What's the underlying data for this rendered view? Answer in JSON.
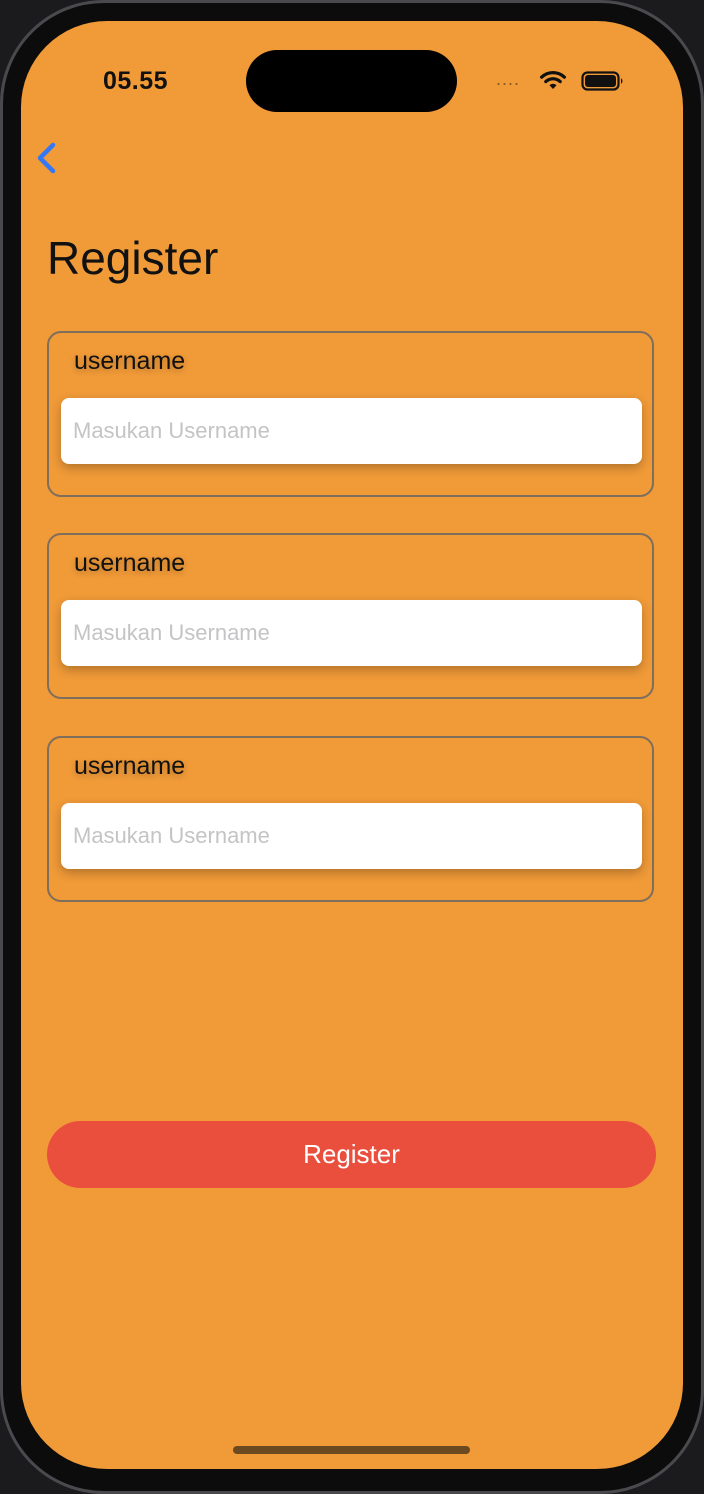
{
  "status_bar": {
    "time": "05.55",
    "signal": "....",
    "icons": [
      "wifi-icon",
      "battery-icon"
    ]
  },
  "nav": {
    "back_icon": "chevron-left-icon"
  },
  "page": {
    "title": "Register"
  },
  "fields": [
    {
      "label": "username",
      "placeholder": "Masukan Username",
      "value": ""
    },
    {
      "label": "username",
      "placeholder": "Masukan Username",
      "value": ""
    },
    {
      "label": "username",
      "placeholder": "Masukan Username",
      "value": ""
    }
  ],
  "actions": {
    "register_label": "Register"
  },
  "colors": {
    "background": "#f09a38",
    "button": "#ea4f3d",
    "back_icon": "#3478f6"
  }
}
